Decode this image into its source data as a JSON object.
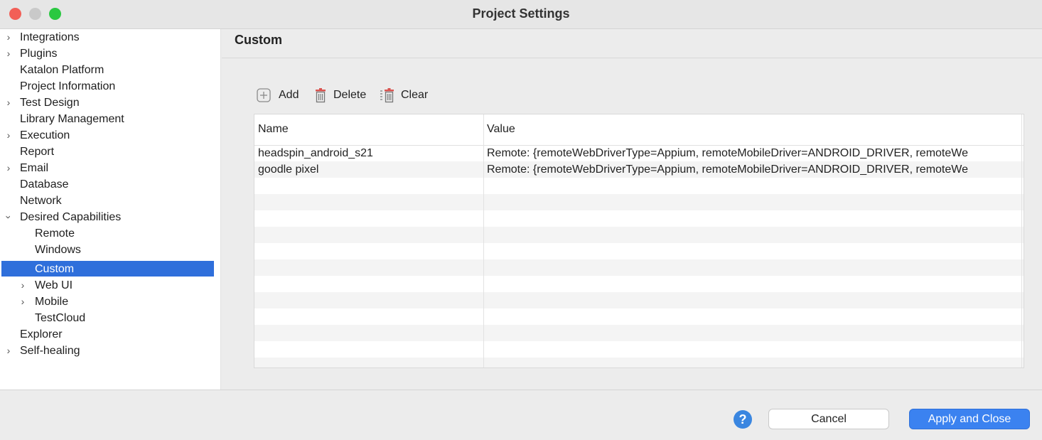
{
  "window": {
    "title": "Project Settings"
  },
  "sidebar": {
    "items": [
      {
        "label": "Integrations",
        "expandable": true,
        "state": "collapsed"
      },
      {
        "label": "Plugins",
        "expandable": true,
        "state": "collapsed"
      },
      {
        "label": "Katalon Platform"
      },
      {
        "label": "Project Information"
      },
      {
        "label": "Test Design",
        "expandable": true,
        "state": "collapsed"
      },
      {
        "label": "Library Management"
      },
      {
        "label": "Execution",
        "expandable": true,
        "state": "collapsed"
      },
      {
        "label": "Report"
      },
      {
        "label": "Email",
        "expandable": true,
        "state": "collapsed"
      },
      {
        "label": "Database"
      },
      {
        "label": "Network"
      },
      {
        "label": "Desired Capabilities",
        "expandable": true,
        "state": "expanded"
      },
      {
        "label": "Remote",
        "child": true
      },
      {
        "label": "Windows",
        "child": true
      },
      {
        "label": "Custom",
        "child": true,
        "selected": true
      },
      {
        "label": "Web UI",
        "child": true,
        "expandable": true,
        "state": "collapsed"
      },
      {
        "label": "Mobile",
        "child": true,
        "expandable": true,
        "state": "collapsed"
      },
      {
        "label": "TestCloud",
        "child": true
      },
      {
        "label": "Explorer"
      },
      {
        "label": "Self-healing",
        "expandable": true,
        "state": "collapsed"
      }
    ]
  },
  "panel": {
    "title": "Custom",
    "toolbar": {
      "add_label": "Add",
      "delete_label": "Delete",
      "clear_label": "Clear"
    },
    "table": {
      "columns": [
        "Name",
        "Value"
      ],
      "rows": [
        {
          "name": "headspin_android_s21",
          "value": "Remote: {remoteWebDriverType=Appium, remoteMobileDriver=ANDROID_DRIVER, remoteWe"
        },
        {
          "name": "goodle pixel",
          "value": "Remote: {remoteWebDriverType=Appium, remoteMobileDriver=ANDROID_DRIVER, remoteWe"
        }
      ]
    }
  },
  "footer": {
    "help_label": "?",
    "cancel_label": "Cancel",
    "apply_label": "Apply and Close"
  },
  "colors": {
    "selection": "#2f6fdb",
    "primary_button": "#3b82f0",
    "close": "#f25f57",
    "maximize": "#2ac841"
  }
}
